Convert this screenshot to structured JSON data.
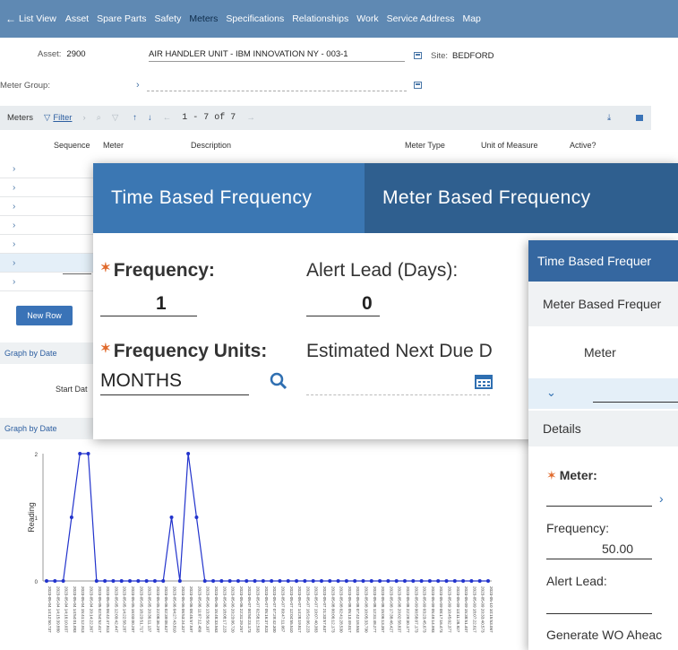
{
  "nav": {
    "back_label": "List View",
    "tabs": [
      "Asset",
      "Spare Parts",
      "Safety",
      "Meters",
      "Specifications",
      "Relationships",
      "Work",
      "Service Address",
      "Map"
    ],
    "active_tab": "Meters"
  },
  "asset": {
    "asset_label": "Asset:",
    "asset_value": "2900",
    "description": "AIR HANDLER UNIT - IBM INNOVATION NY - 003-1",
    "site_label": "Site:",
    "site_value": "BEDFORD",
    "meter_group_label": "Meter Group:"
  },
  "meters_toolbar": {
    "title": "Meters",
    "filter_label": "Filter",
    "pager": "1 - 7 of 7"
  },
  "meters_table": {
    "columns": [
      "Sequence",
      "Meter",
      "Description",
      "Meter Type",
      "Unit of Measure",
      "Active?"
    ],
    "row_count": 7,
    "new_row_label": "New Row"
  },
  "graph": {
    "section1_label": "Graph by Date",
    "start_date_label": "Start Dat",
    "section2_label": "Graph by Date"
  },
  "chart_data": {
    "type": "line",
    "ylabel": "Reading",
    "ylim": [
      0,
      2
    ],
    "yticks": [
      "0",
      "1",
      "2"
    ],
    "x": [
      "2023-05-04 14:12:50.737",
      "2023-05-04 14:15:39.880",
      "2023-05-04 14:16:10.037",
      "2023-05-04 14:54:01.083",
      "2023-05-04 15:41:12.913",
      "2023-05-04 20:14:22.367",
      "2023-05-05 02:54:52.417",
      "2023-05-05 06:42:47.813",
      "2023-05-05 12:09:42.447",
      "2023-05-05 14:22:58.287",
      "2023-05-05 16:03:00.287",
      "2023-05-05 18:23:51.717",
      "2023-05-05 20:36:11.137",
      "2023-05-05 22:08:36.297",
      "2023-05-06 02:39:08.627",
      "2023-05-06 04:27:43.810",
      "2023-05-06 06:53:24.327",
      "2023-05-06 08:45:57.597",
      "2023-05-06 11:07:12.480",
      "2023-05-06 13:36:56.107",
      "2023-05-06 15:48:33.563",
      "2023-05-06 18:08:17.223",
      "2023-05-06 20:23:06.720",
      "2023-05-06 22:31:29.257",
      "2023-05-07 00:50:23.173",
      "2023-05-07 02:58:12.593",
      "2023-05-07 05:16:37.823",
      "2023-05-07 07:29:42.300",
      "2023-05-07 09:47:11.067",
      "2023-05-07 12:04:55.510",
      "2023-05-07 14:28:19.817",
      "2023-05-07 16:51:06.223",
      "2023-05-07 19:07:40.383",
      "2023-05-07 21:33:57.637",
      "2023-05-08 00:06:12.173",
      "2023-05-08 02:41:28.530",
      "2023-05-08 05:13:49.017",
      "2023-05-08 07:42:18.553",
      "2023-05-08 10:05:33.790",
      "2023-05-08 12:31:48.277",
      "2023-05-08 15:06:13.357",
      "2023-05-08 17:38:46.427",
      "2023-05-08 20:02:58.837",
      "2023-05-08 22:29:30.177",
      "2023-05-09 00:58:07.173",
      "2023-05-09 03:23:45.673",
      "2023-05-09 05:49:14.993",
      "2023-05-09 08:17:16.473",
      "2023-05-09 10:45:02.377",
      "2023-05-09 13:11:28.927",
      "2023-05-09 15:38:51.407",
      "2023-05-09 18:07:22.617",
      "2023-05-09 20:33:40.573",
      "2023-05-10 10:15:53.067"
    ],
    "series": [
      {
        "values": [
          0,
          0,
          0,
          1,
          2,
          2,
          0,
          0,
          0,
          0,
          0,
          0,
          0,
          0,
          0,
          1,
          0,
          2,
          1,
          0,
          0,
          0,
          0,
          0,
          0,
          0,
          0,
          0,
          0,
          0,
          0,
          0,
          0,
          0,
          0,
          0,
          0,
          0,
          0,
          0,
          0,
          0,
          0,
          0,
          0,
          0,
          0,
          0,
          0,
          0,
          0,
          0,
          0,
          0
        ]
      }
    ],
    "color": "#2233cc"
  },
  "popup_time_based": {
    "tab1": "Time Based Frequency",
    "tab2": "Meter Based Frequency",
    "frequency_label": "Frequency:",
    "frequency_value": "1",
    "alert_lead_label": "Alert Lead (Days):",
    "alert_lead_value": "0",
    "frequency_units_label": "Frequency Units:",
    "frequency_units_value": "MONTHS",
    "estimated_label": "Estimated Next Due D"
  },
  "popup_meter_based": {
    "section1": "Time Based Frequer",
    "section2": "Meter Based Frequer",
    "meter_col": "Meter",
    "details_label": "Details",
    "meter_label": "Meter:",
    "frequency_label": "Frequency:",
    "frequency_value": "50.00",
    "alert_lead_label": "Alert Lead:",
    "generate_label": "Generate WO Aheac"
  },
  "colors": {
    "nav_bg": "#5f89b3",
    "popup_tab_bg": "#2f5f8f",
    "popup_tab_active": "#3b77b3",
    "required": "#e06a2c",
    "button": "#3a73b7"
  }
}
